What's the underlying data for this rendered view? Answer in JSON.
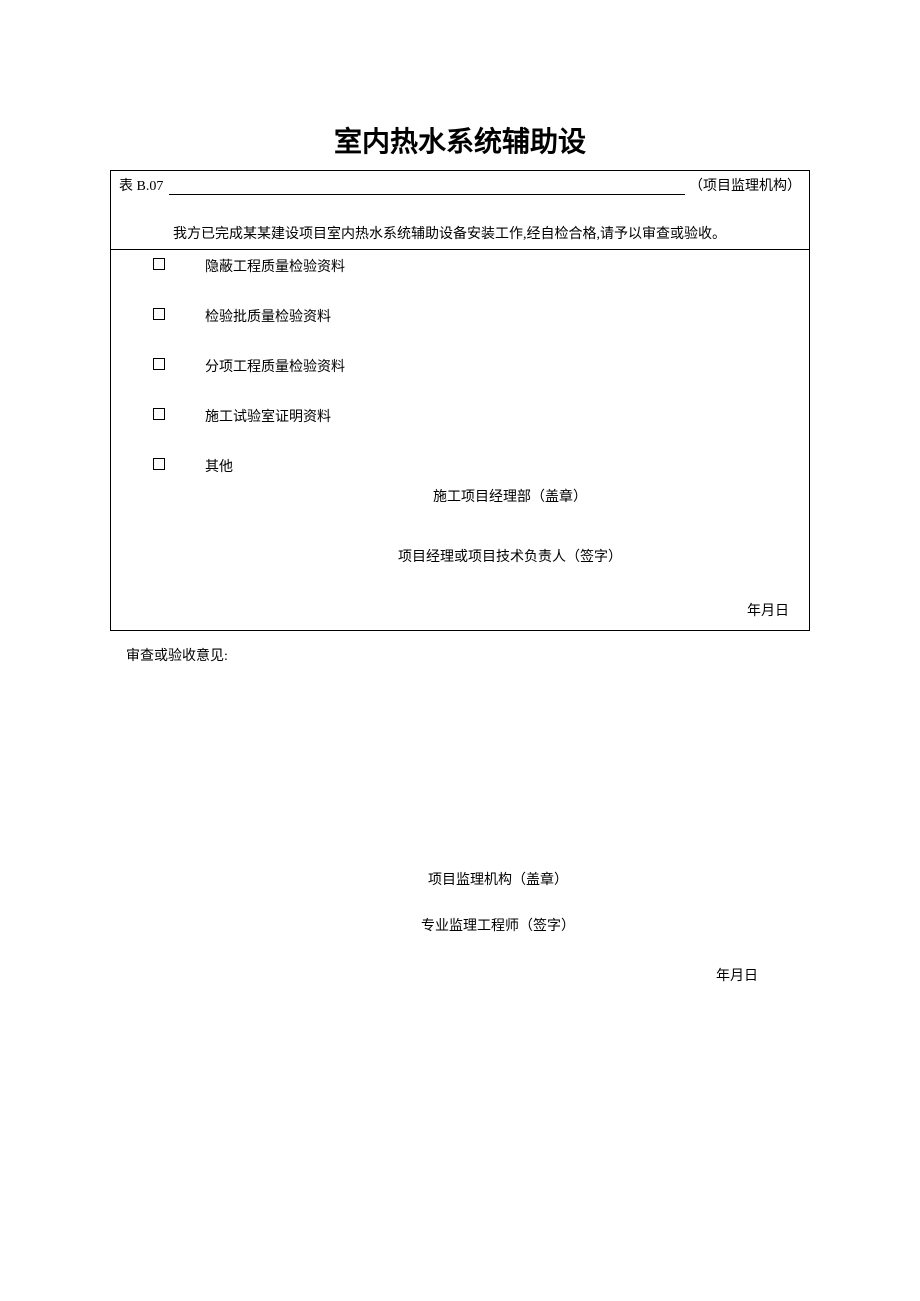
{
  "title": "室内热水系统辅助设",
  "table_number": "表 B.07",
  "org_suffix": "（项目监理机构）",
  "intro": "我方已完成某某建设项目室内热水系统辅助设备安装工作,经自检合格,请予以审查或验收。",
  "checkboxes": [
    "隐蔽工程质量检验资料",
    "检验批质量检验资料",
    "分项工程质量检验资料",
    "施工试验室证明资料",
    "其他"
  ],
  "stamp_line": "施工项目经理部（盖章）",
  "sign_line": "项目经理或项目技术负责人（签字）",
  "date_text": "年月日",
  "review_label": "审查或验收意见:",
  "review_stamp": "项目监理机构（盖章）",
  "review_sign": "专业监理工程师（签字）",
  "review_date": "年月日"
}
